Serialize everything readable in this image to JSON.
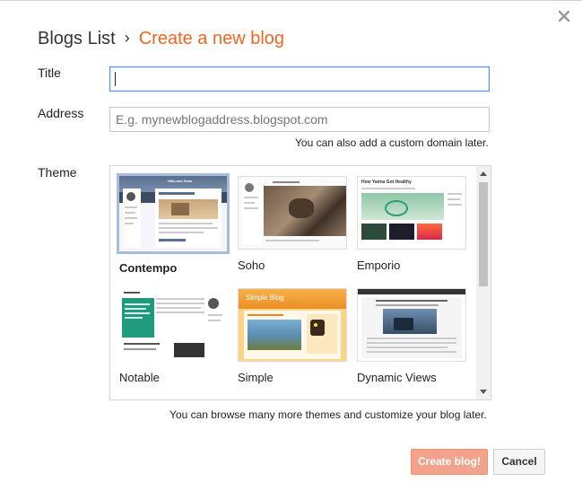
{
  "header": {
    "breadcrumb": "Blogs List",
    "separator": "›",
    "current": "Create a new blog"
  },
  "form": {
    "title_label": "Title",
    "title_value": "",
    "address_label": "Address",
    "address_placeholder": "E.g. mynewblogaddress.blogspot.com",
    "address_hint": "You can also add a custom domain later.",
    "theme_label": "Theme",
    "theme_hint": "You can browse many more themes and customize your blog later."
  },
  "themes": [
    {
      "name": "Contempo",
      "selected": true
    },
    {
      "name": "Soho",
      "selected": false
    },
    {
      "name": "Emporio",
      "selected": false
    },
    {
      "name": "Notable",
      "selected": false
    },
    {
      "name": "Simple",
      "selected": false
    },
    {
      "name": "Dynamic Views",
      "selected": false
    }
  ],
  "thumbnail_text": {
    "contempo_banner": "Hills and Seas",
    "emporio_heading": "How Yaima Got Healthy",
    "simple_heading": "Simple Blog"
  },
  "buttons": {
    "create": "Create blog!",
    "cancel": "Cancel"
  },
  "colors": {
    "accent": "#ee6622",
    "focus_border": "#4d90fe",
    "create_button": "#f3a38b",
    "selected_theme_border": "#a9bcda"
  },
  "icons": {
    "close": "close-icon"
  }
}
